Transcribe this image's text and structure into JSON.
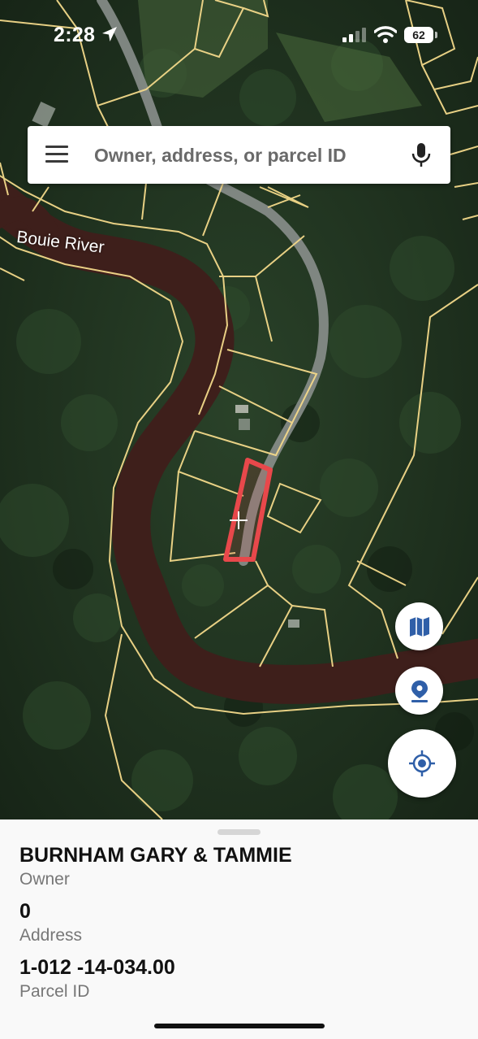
{
  "status_bar": {
    "time": "2:28",
    "battery": "62"
  },
  "search": {
    "placeholder": "Owner, address, or parcel ID"
  },
  "map": {
    "labels": {
      "river": "Bouie River"
    },
    "colors": {
      "forest": "#1f3320",
      "river": "#3e1f1b",
      "parcel_lines": "#f3d98a",
      "selected_parcel": "#e8484b",
      "road": "#8a8f8c"
    }
  },
  "buttons": {
    "layers_icon": "map-icon",
    "pin_icon": "location-pin-icon",
    "locate_icon": "my-location-icon",
    "accent": "#2f5fa8"
  },
  "parcel": {
    "owner": "BURNHAM GARY & TAMMIE",
    "owner_label": "Owner",
    "address": "0",
    "address_label": "Address",
    "parcel_id": "1-012 -14-034.00",
    "parcel_id_label": "Parcel ID"
  }
}
